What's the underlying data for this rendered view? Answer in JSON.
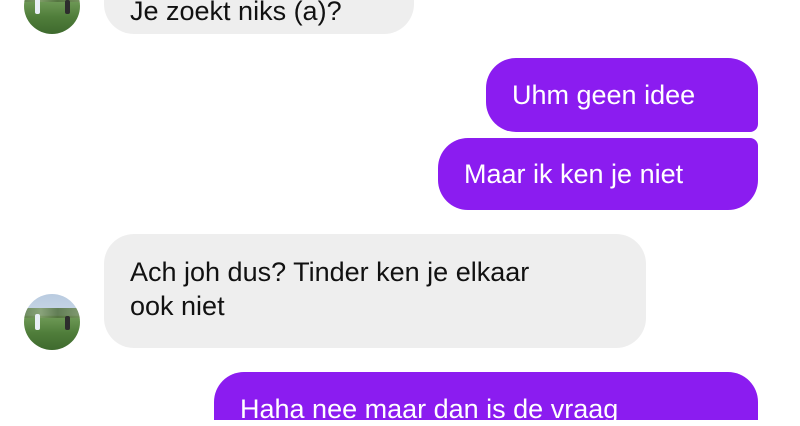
{
  "conversation": {
    "messages": [
      {
        "direction": "incoming",
        "lines": [
          "Je zoekt niks (a)?"
        ]
      },
      {
        "direction": "outgoing",
        "lines": [
          "Uhm geen idee"
        ]
      },
      {
        "direction": "outgoing",
        "lines": [
          "Maar ik ken je niet"
        ]
      },
      {
        "direction": "incoming",
        "lines": [
          "Ach joh dus? Tinder ken je elkaar",
          "ook niet"
        ]
      },
      {
        "direction": "outgoing",
        "lines": [
          "Haha nee maar dan is de vraag"
        ]
      }
    ]
  },
  "colors": {
    "outgoing_bubble": "#8b1cf0",
    "incoming_bubble": "#eeeeee",
    "outgoing_text": "#ffffff",
    "incoming_text": "#111111"
  },
  "icons": {
    "contact_avatar": "contact-avatar"
  }
}
